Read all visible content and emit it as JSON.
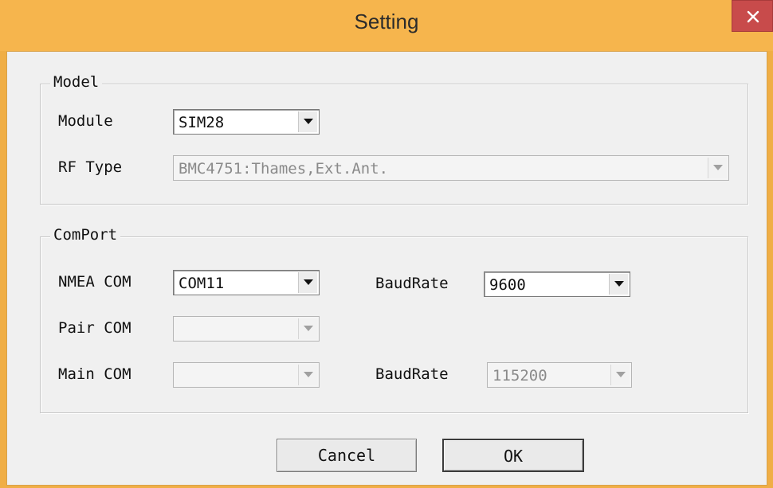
{
  "window": {
    "title": "Setting",
    "close_icon": "close-icon",
    "title_bar_color": "#f6b54d",
    "close_color": "#c84b4b"
  },
  "model_group": {
    "legend": "Model",
    "module_label": "Module",
    "module_value": "SIM28",
    "rf_type_label": "RF Type",
    "rf_type_value": "BMC4751:Thames,Ext.Ant."
  },
  "comport_group": {
    "legend": "ComPort",
    "nmea_com_label": "NMEA COM",
    "nmea_com_value": "COM11",
    "baudrate1_label": "BaudRate",
    "baudrate1_value": "9600",
    "pair_com_label": "Pair COM",
    "pair_com_value": "",
    "main_com_label": "Main COM",
    "main_com_value": "",
    "baudrate2_label": "BaudRate",
    "baudrate2_value": "115200"
  },
  "buttons": {
    "cancel": "Cancel",
    "ok": "OK"
  },
  "icons": {
    "dropdown": "chevron-down-icon"
  }
}
